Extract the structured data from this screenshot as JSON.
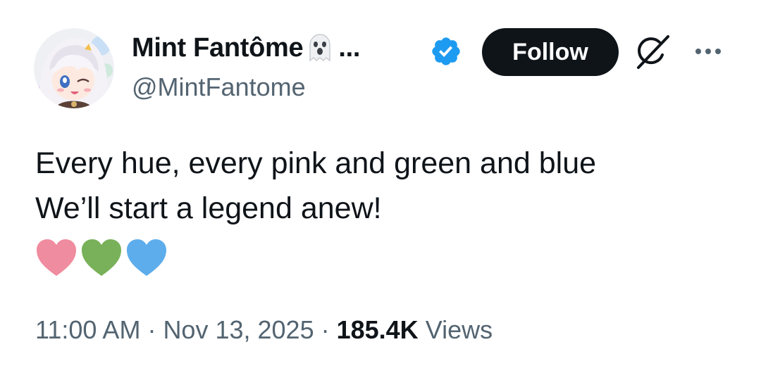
{
  "author": {
    "display_name": "Mint Fantôme",
    "name_truncation": "...",
    "handle": "@MintFantome",
    "verified": true,
    "name_emoji": "ghost-icon"
  },
  "actions": {
    "follow_label": "Follow",
    "grok_icon": "grok-slash-icon",
    "more_icon": "more-dots-icon"
  },
  "tweet": {
    "lines": [
      "Every hue, every pink and green and blue",
      "We’ll start a legend anew!"
    ],
    "hearts": [
      {
        "icon": "pink-heart-icon",
        "color": "#f08c9f"
      },
      {
        "icon": "green-heart-icon",
        "color": "#78b159"
      },
      {
        "icon": "blue-heart-icon",
        "color": "#5dadec"
      }
    ]
  },
  "meta": {
    "time": "11:00 AM",
    "separator": " · ",
    "date": "Nov 13, 2025",
    "views_count": "185.4K",
    "views_label": "Views"
  },
  "colors": {
    "primary_text": "#0f1419",
    "secondary_text": "#536471",
    "verified_blue": "#1d9bf0",
    "follow_bg": "#0f1419"
  }
}
